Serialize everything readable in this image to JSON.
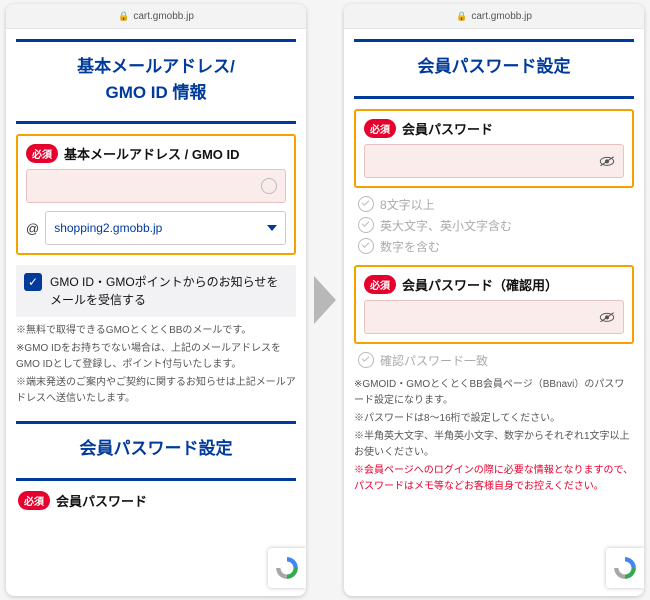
{
  "url": "cart.gmobb.jp",
  "required_badge": "必須",
  "at_sign": "@",
  "left": {
    "title_line1": "基本メールアドレス/",
    "title_line2": "GMO ID 情報",
    "field_label": "基本メールアドレス / GMO ID",
    "domain_value": "shopping2.gmobb.jp",
    "optin_text": "GMO ID・GMOポイントからのお知らせをメールを受信する",
    "notes": [
      "※無料で取得できるGMOとくとくBBのメールです。",
      "※GMO IDをお持ちでない場合は、上記のメールアドレスをGMO IDとして登録し、ポイント付与いたします。",
      "※端末発送のご案内やご契約に関するお知らせは上記メールアドレスへ送信いたします。"
    ],
    "next_title": "会員パスワード設定",
    "next_field_label": "会員パスワード"
  },
  "right": {
    "title": "会員パスワード設定",
    "pw_label": "会員パスワード",
    "pw_rules": [
      "8文字以上",
      "英大文字、英小文字含む",
      "数字を含む"
    ],
    "pw_confirm_label": "会員パスワード（確認用）",
    "pw_confirm_rules": [
      "確認パスワード一致"
    ],
    "notes": [
      "※GMOID・GMOとくとくBB会員ページ（BBnavi）のパスワード設定になります。",
      "※パスワードは8〜16桁で設定してください。",
      "※半角英大文字、半角英小文字、数字からそれぞれ1文字以上お使いください。"
    ],
    "warn": "※会員ページへのログインの際に必要な情報となりますので、パスワードはメモ等などお客様自身でお控えください。"
  }
}
